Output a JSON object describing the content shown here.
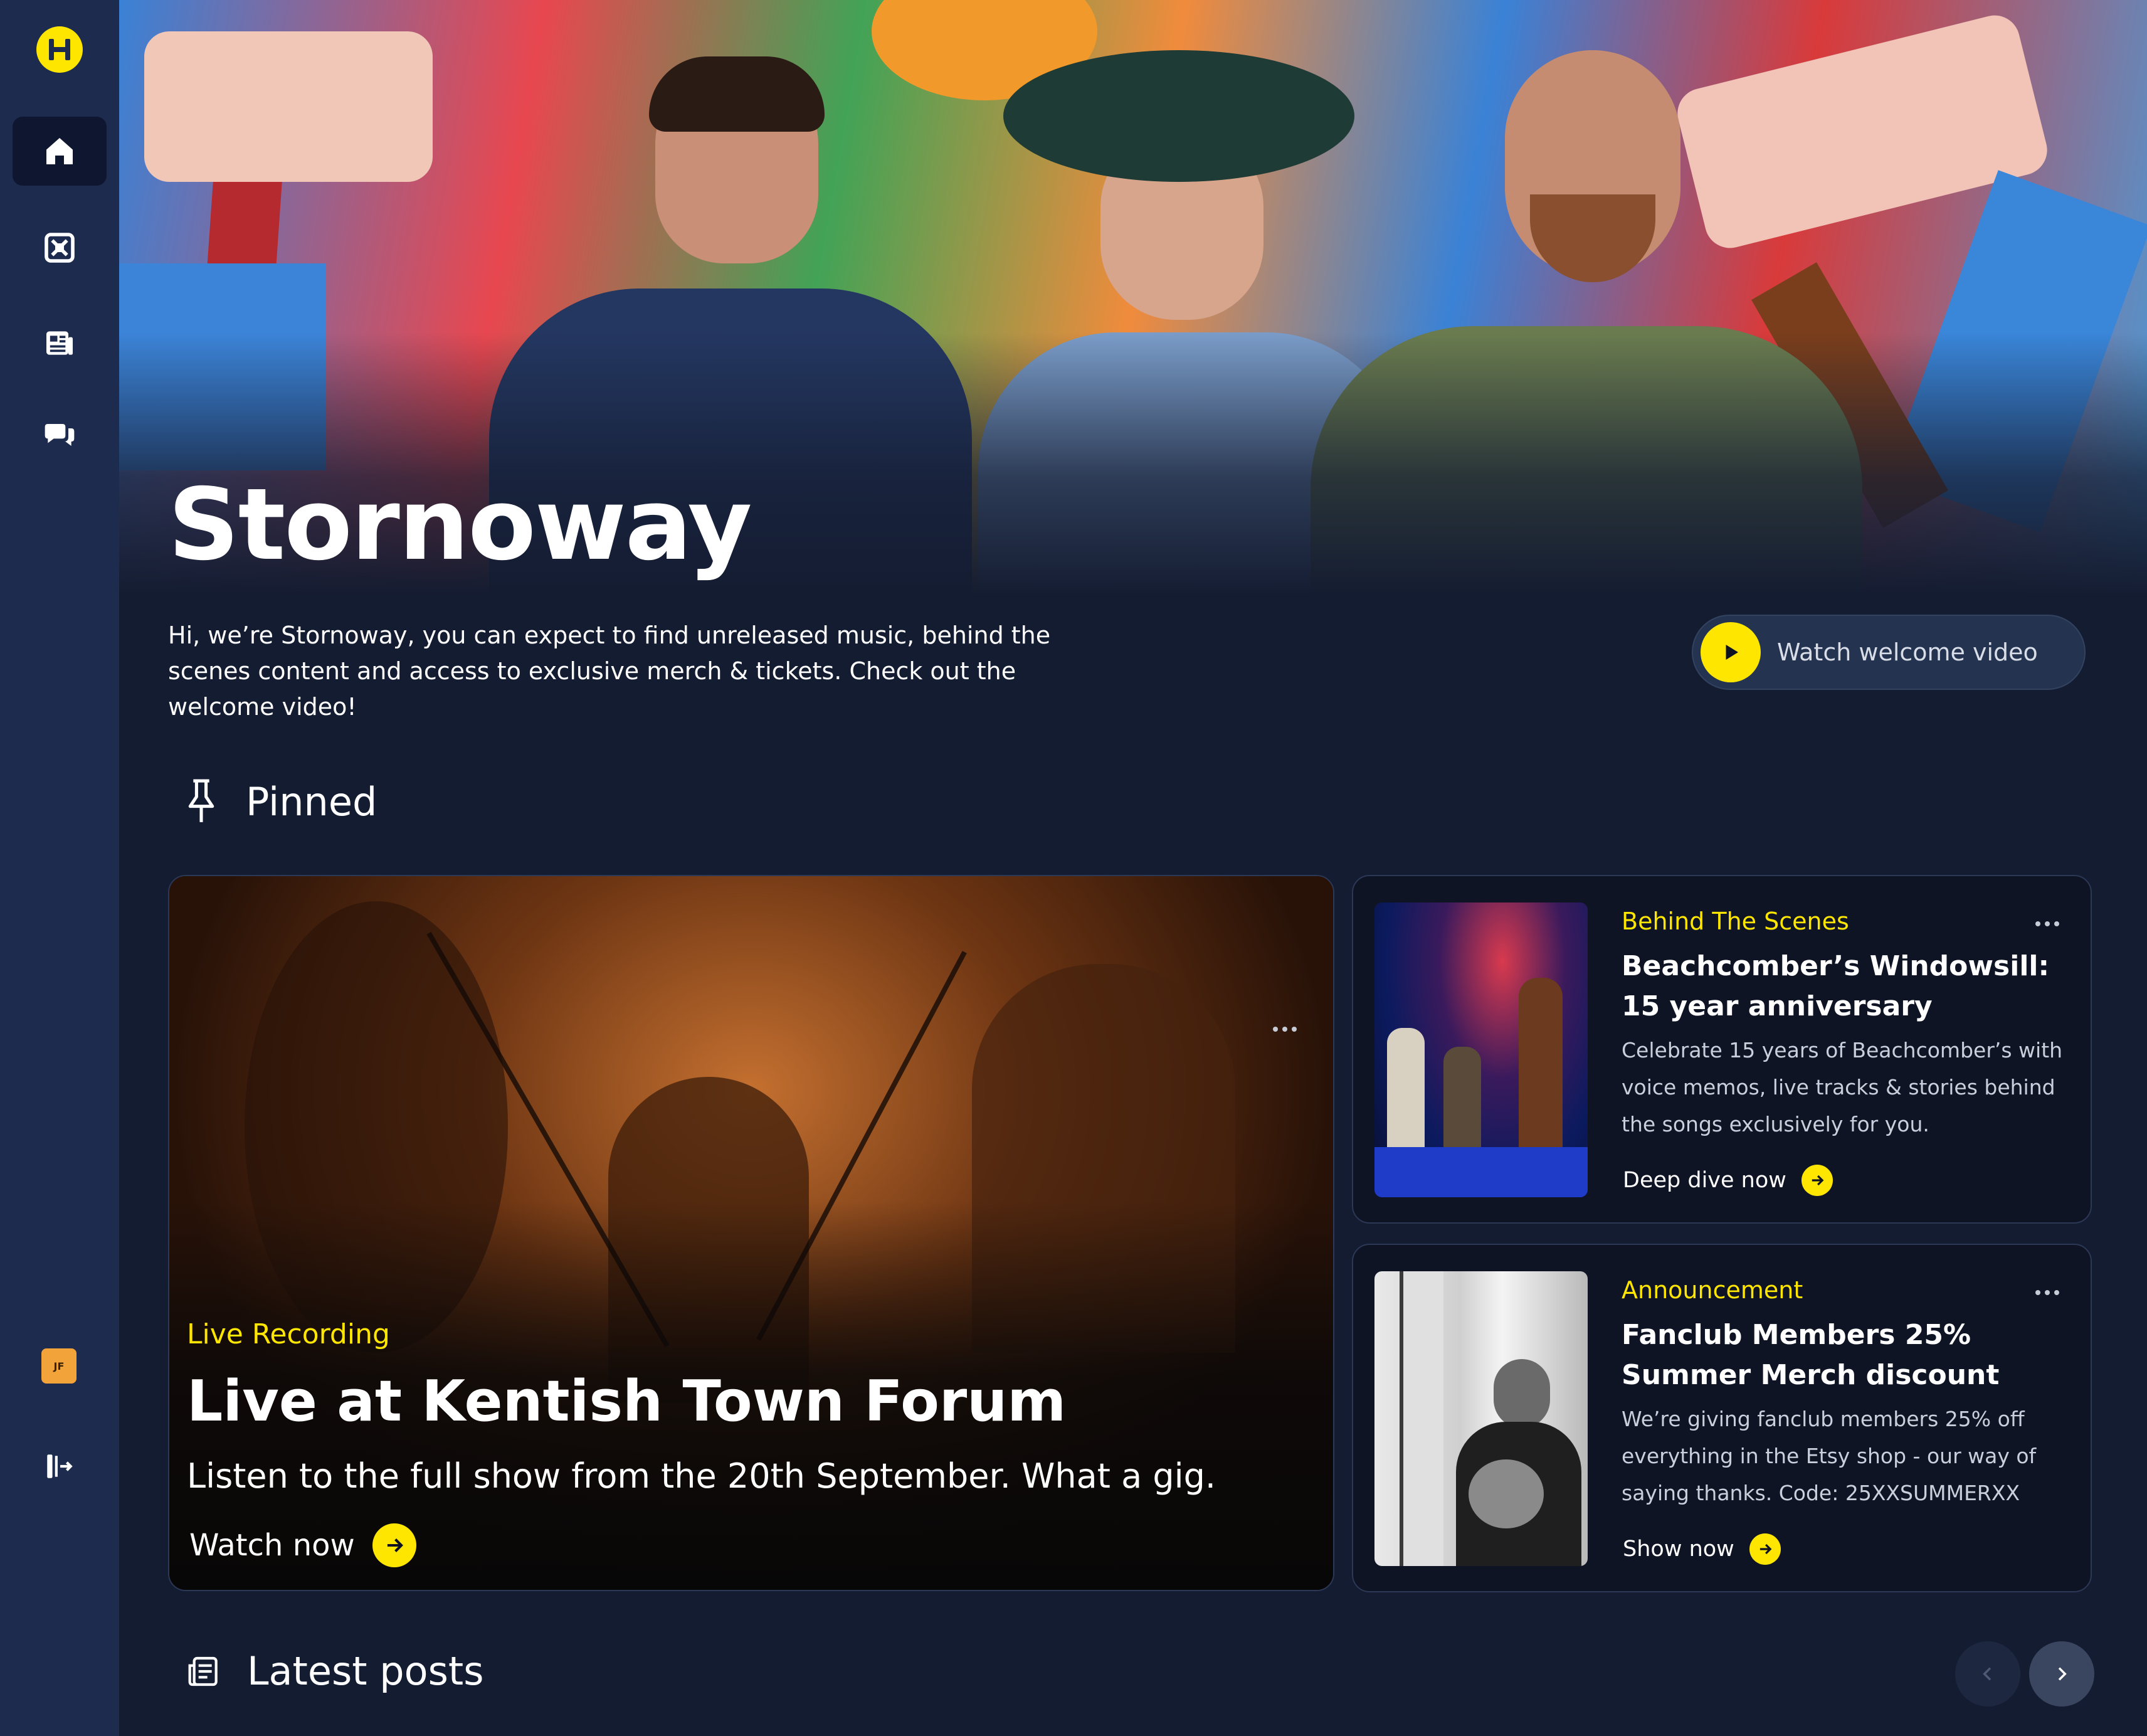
{
  "sidebar": {
    "logo_icon": "logo-icon",
    "nav": [
      {
        "id": "home",
        "icon": "home-icon",
        "active": true
      },
      {
        "id": "media",
        "icon": "media-icon",
        "active": false
      },
      {
        "id": "news",
        "icon": "newspaper-icon",
        "active": false
      },
      {
        "id": "chat",
        "icon": "chat-icon",
        "active": false
      }
    ],
    "avatar_initials": "JF",
    "logout_icon": "logout-icon"
  },
  "hero": {
    "artist_name": "Stornoway",
    "description": "Hi, we’re Stornoway, you can expect to find unreleased music, behind the scenes content and access to exclusive merch & tickets. Check out the welcome video!",
    "welcome_button": "Watch welcome video"
  },
  "pinned": {
    "heading": "Pinned",
    "feature": {
      "category": "Live Recording",
      "title": "Live at Kentish Town Forum",
      "description": "Listen to the full show from the 20th September. What a gig.",
      "cta": "Watch now"
    },
    "cards": [
      {
        "category": "Behind The Scenes",
        "title": "Beachcomber’s Windowsill: 15 year anniversary",
        "description": "Celebrate 15 years of Beachcomber’s with voice memos, live tracks & stories behind the songs exclusively for you.",
        "cta": "Deep dive now"
      },
      {
        "category": "Announcement",
        "title": "Fanclub Members 25% Summer Merch discount",
        "description": "We’re giving fanclub members 25% off everything in the Etsy shop - our way of saying thanks. Code: 25XXSUMMERXX",
        "cta": "Show now"
      }
    ]
  },
  "latest": {
    "heading": "Latest posts"
  },
  "colors": {
    "accent": "#ffe600",
    "sidebar": "#1c2b4e",
    "background": "#141c31"
  }
}
